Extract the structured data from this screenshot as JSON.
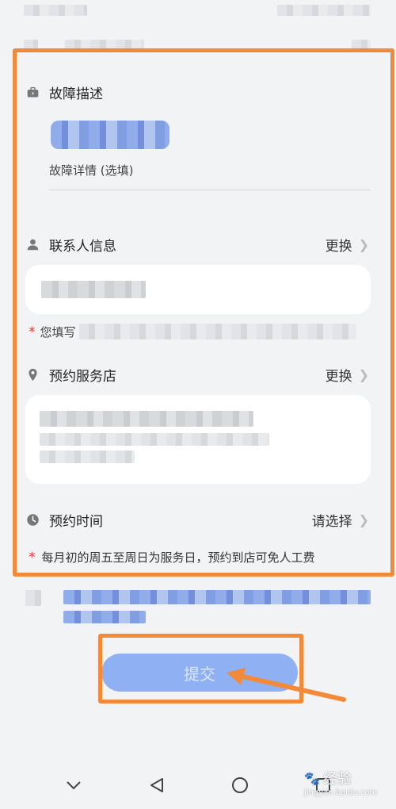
{
  "fault_section": {
    "title": "故障描述",
    "details_placeholder": "故障详情 (选填)"
  },
  "contact_section": {
    "title": "联系人信息",
    "change_label": "更换",
    "note_prefix": "*",
    "note_visible_text": "您填写"
  },
  "store_section": {
    "title": "预约服务店",
    "change_label": "更换"
  },
  "time_section": {
    "title": "预约时间",
    "select_label": "请选择",
    "notice_star": "*",
    "notice_text": "每月初的周五至周日为服务日，预约到店可免人工费"
  },
  "submit": {
    "label": "提交"
  },
  "watermark": {
    "text": "经验",
    "subtext": "jingyan.baidu.com"
  },
  "colors": {
    "highlight_orange": "#f28a3a",
    "submit_blue": "#8fb1f3",
    "asterisk_red": "#e53935"
  },
  "icons": {
    "fault": "toolbox-icon",
    "contact": "person-icon",
    "store": "location-pin-icon",
    "time": "clock-icon",
    "chevron": "chevron-right-icon",
    "nav": [
      "chevron-down-icon",
      "back-triangle-icon",
      "home-circle-icon",
      "recents-square-icon"
    ]
  }
}
